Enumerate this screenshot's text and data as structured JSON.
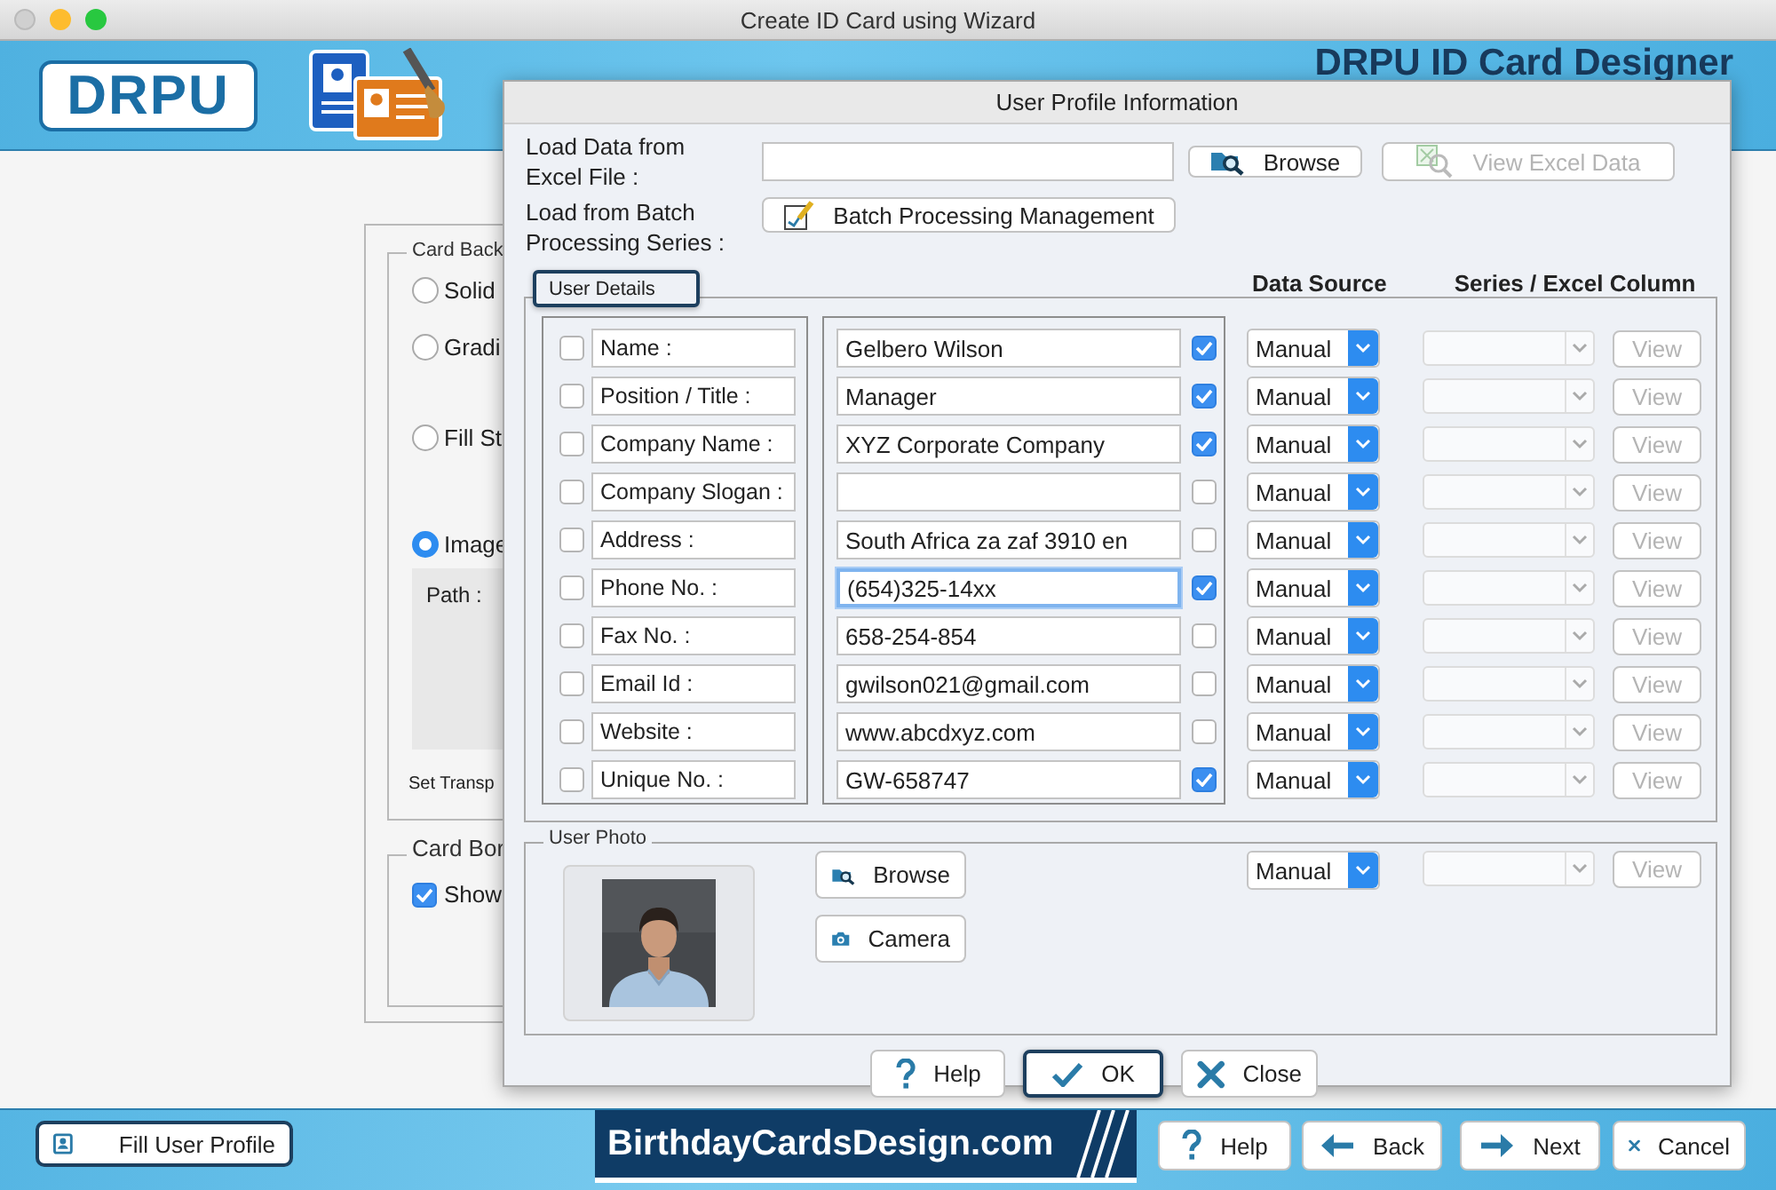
{
  "window": {
    "title": "Create ID Card using Wizard"
  },
  "header": {
    "logo": "DRPU",
    "product_title": "DRPU ID Card Designer"
  },
  "background_panel": {
    "group_title": "Card Back",
    "options": [
      {
        "label": "Solid",
        "selected": false
      },
      {
        "label": "Gradi",
        "selected": false
      },
      {
        "label": "Fill St",
        "selected": false
      },
      {
        "label": "Image",
        "selected": true
      }
    ],
    "path_label": "Path :",
    "transparency_label": "Set Transp",
    "border_group_title": "Card Bor",
    "border_checkbox": {
      "label": "Show",
      "checked": true
    }
  },
  "dialog": {
    "title": "User Profile Information",
    "excel_label": [
      "Load Data from",
      "Excel File :"
    ],
    "browse_button": "Browse",
    "view_excel_button": {
      "label": "View Excel Data",
      "disabled": true
    },
    "batch_label": [
      "Load from Batch",
      "Processing Series :"
    ],
    "batch_button": "Batch Processing Management",
    "user_details": {
      "legend": "User Details",
      "focused": true,
      "headings": [
        "Data Source",
        "Series / Excel Column"
      ],
      "fields": [
        {
          "label": "Name :",
          "label_checked": false,
          "value": "Gelbero Wilson",
          "value_checked": true,
          "focused": false,
          "source": "Manual",
          "view_button": "View",
          "excel_column_disabled": true
        },
        {
          "label": "Position / Title :",
          "label_checked": false,
          "value": "Manager",
          "value_checked": true,
          "focused": false,
          "source": "Manual",
          "view_button": "View",
          "excel_column_disabled": true
        },
        {
          "label": "Company Name :",
          "label_checked": false,
          "value": "XYZ Corporate Company",
          "value_checked": true,
          "focused": false,
          "source": "Manual",
          "view_button": "View",
          "excel_column_disabled": true
        },
        {
          "label": "Company Slogan :",
          "label_checked": false,
          "value_checked": false,
          "focused": false,
          "source": "Manual",
          "view_button": "View",
          "excel_column_disabled": true
        },
        {
          "label": "Address :",
          "label_checked": false,
          "value": "South Africa za zaf 3910 en",
          "value_checked": false,
          "focused": false,
          "source": "Manual",
          "view_button": "View",
          "excel_column_disabled": true
        },
        {
          "label": "Phone No. :",
          "label_checked": false,
          "value": "(654)325-14xx",
          "value_checked": true,
          "focused": true,
          "source": "Manual",
          "view_button": "View",
          "excel_column_disabled": true
        },
        {
          "label": "Fax No. :",
          "label_checked": false,
          "value": "658-254-854",
          "value_checked": false,
          "focused": false,
          "source": "Manual",
          "view_button": "View",
          "excel_column_disabled": true
        },
        {
          "label": "Email Id :",
          "label_checked": false,
          "value": "gwilson021@gmail.com",
          "value_checked": false,
          "focused": false,
          "source": "Manual",
          "view_button": "View",
          "excel_column_disabled": true
        },
        {
          "label": "Website :",
          "label_checked": false,
          "value": "www.abcdxyz.com",
          "value_checked": false,
          "focused": false,
          "source": "Manual",
          "view_button": "View",
          "excel_column_disabled": true
        },
        {
          "label": "Unique No. :",
          "label_checked": false,
          "value": "GW-658747",
          "value_checked": true,
          "focused": false,
          "source": "Manual",
          "view_button": "View",
          "excel_column_disabled": true
        }
      ]
    },
    "user_photo": {
      "legend": "User Photo",
      "browse_button": "Browse",
      "camera_button": "Camera",
      "source": "Manual",
      "view_button": "View",
      "excel_column_disabled": true
    },
    "buttons": [
      {
        "label": "Help",
        "kind": "help",
        "focused": false
      },
      {
        "label": "OK",
        "kind": "ok",
        "focused": true
      },
      {
        "label": "Close",
        "kind": "close",
        "focused": false
      }
    ]
  },
  "footer": {
    "profile_button": "Fill User Profile",
    "brand": "BirthdayCardsDesign.com",
    "buttons": [
      {
        "label": "Help",
        "kind": "help"
      },
      {
        "label": "Back",
        "kind": "back"
      },
      {
        "label": "Next",
        "kind": "next"
      },
      {
        "label": "Cancel",
        "kind": "cancel"
      }
    ]
  }
}
